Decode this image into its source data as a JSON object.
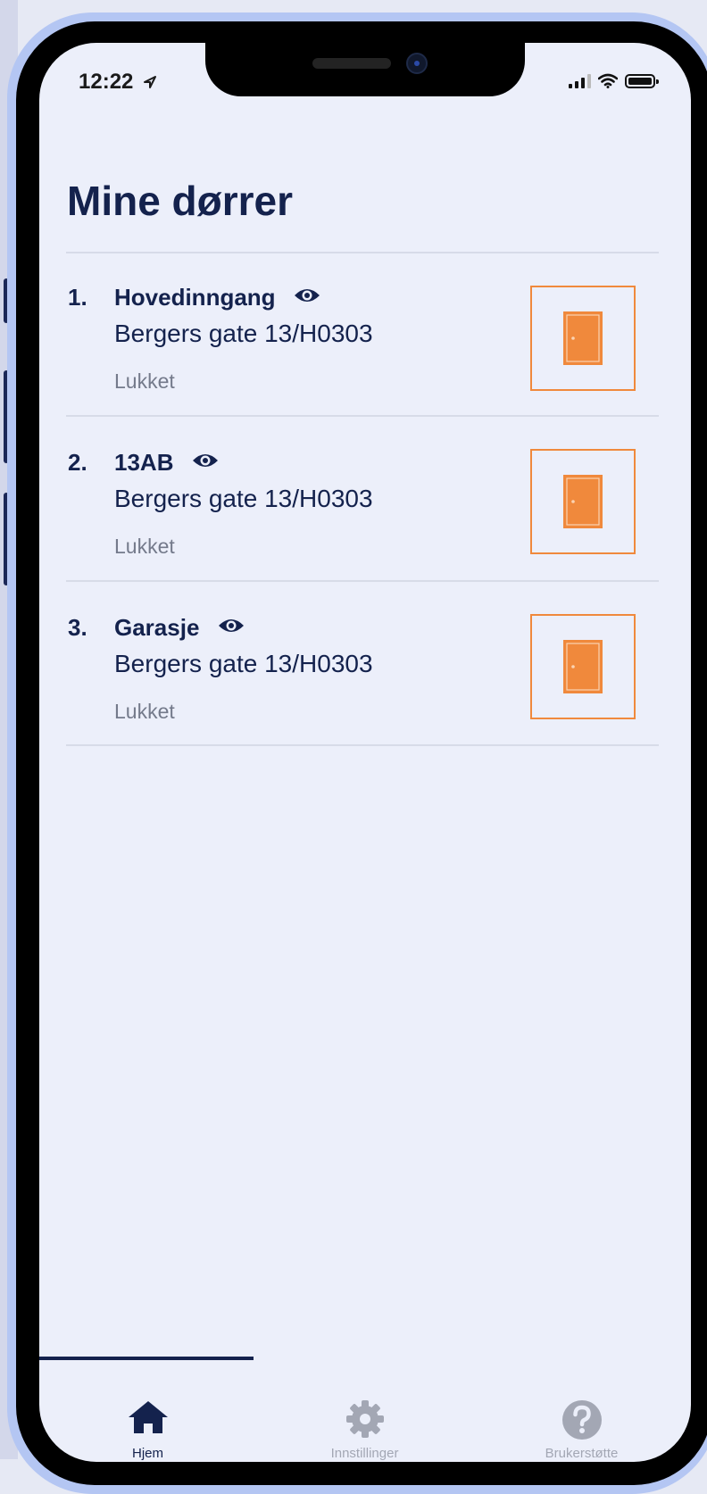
{
  "status_bar": {
    "time": "12:22"
  },
  "page": {
    "title": "Mine dørrer"
  },
  "doors": [
    {
      "number": "1.",
      "name": "Hovedinngang",
      "address": "Bergers gate 13/H0303",
      "status": "Lukket"
    },
    {
      "number": "2.",
      "name": "13AB",
      "address": "Bergers gate 13/H0303",
      "status": "Lukket"
    },
    {
      "number": "3.",
      "name": "Garasje",
      "address": "Bergers gate 13/H0303",
      "status": "Lukket"
    }
  ],
  "tabs": [
    {
      "label": "Hjem",
      "icon": "home-icon",
      "active": true
    },
    {
      "label": "Innstillinger",
      "icon": "gear-icon",
      "active": false
    },
    {
      "label": "Brukerstøtte",
      "icon": "help-icon",
      "active": false
    }
  ],
  "colors": {
    "primary": "#14224d",
    "accent": "#f0893c",
    "screen_background": "#eceffa",
    "inactive_tab": "#a3a7b4",
    "status_text": "#747a8b"
  }
}
